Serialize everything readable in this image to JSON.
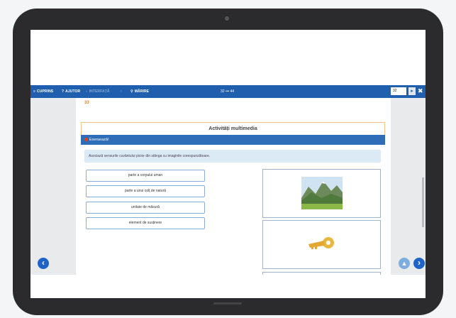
{
  "toolbar": {
    "items": [
      {
        "icon": "list-icon",
        "label": "CUPRINS"
      },
      {
        "icon": "help-icon",
        "label": "AJUTOR"
      },
      {
        "icon": "audio-icon",
        "label": "INTERFAȚĂ"
      },
      {
        "icon": "circle-icon",
        "label": ""
      },
      {
        "icon": "zoom-icon",
        "label": "MĂRIRE"
      }
    ],
    "page_indicator": "32 ••• 44",
    "page_input": "32",
    "go_glyph": "▸",
    "close_glyph": "✖"
  },
  "page_number": "33",
  "section_title": "Activități multimedia",
  "exercise_label": "Exersează!",
  "instruction": "Asociază sensurile cuvântului picior din stânga cu imaginile corespunzătoare.",
  "options": [
    "parte a corpului uman",
    "parte a unui colț de natură",
    "unitate de măsură",
    "element de susținere"
  ],
  "images": [
    "mountain-landscape-image",
    "key-image"
  ],
  "nav": {
    "prev": "‹",
    "next": "›",
    "up": "▲"
  },
  "colors": {
    "toolbar": "#1f5fae",
    "exercise_bar": "#2f6db8",
    "page_number": "#e08020",
    "nav": "#1f63c8"
  }
}
